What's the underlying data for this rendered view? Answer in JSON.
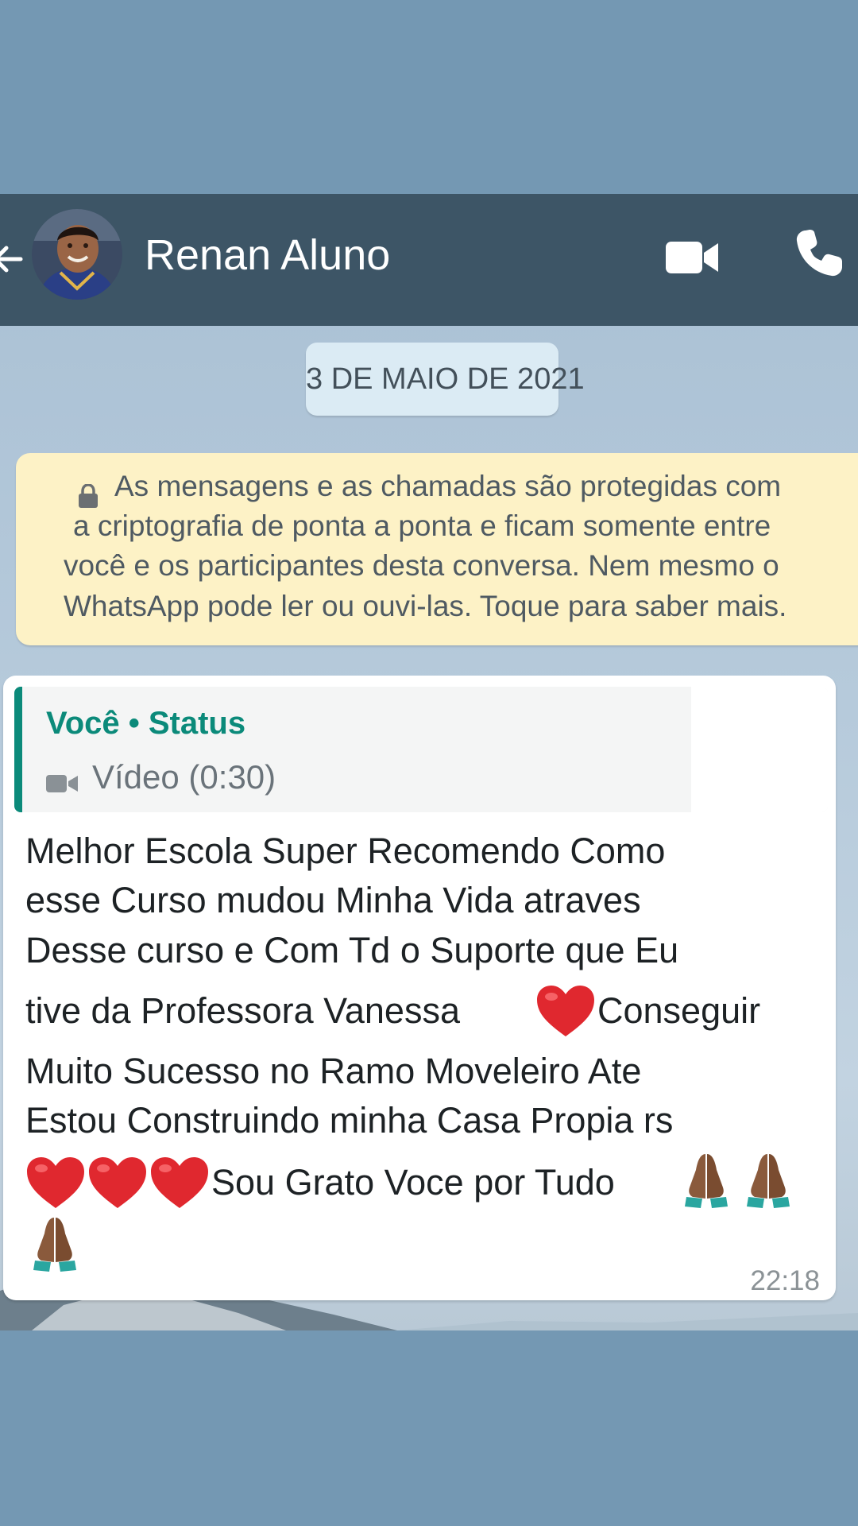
{
  "header": {
    "contact_name": "Renan Aluno",
    "icons": [
      "back-arrow-icon",
      "avatar",
      "video-call-icon",
      "voice-call-icon"
    ]
  },
  "date_chip": "3 DE MAIO DE 2021",
  "encryption_notice": {
    "lines": [
      "As mensagens e as chamadas são protegidas com",
      "a criptografia de ponta a ponta e ficam somente entre",
      "você e os participantes desta conversa. Nem mesmo o",
      "WhatsApp pode ler ou ouvi-las. Toque para saber mais."
    ]
  },
  "message": {
    "quote": {
      "author": "Você • Status",
      "media_label": "Vídeo (0:30)"
    },
    "lines": [
      "Melhor Escola Super Recomendo Como",
      "esse Curso mudou Minha Vida atraves",
      "Desse curso e Com Td o Suporte que Eu",
      "tive da Professora Vanessa",
      " Conseguir",
      "Muito Sucesso no Ramo Moveleiro Ate",
      "Estou Construindo minha Casa Propia rs",
      "Sou Grato Voce por Tudo"
    ],
    "emoji": [
      "❤️",
      "❤️",
      "❤️",
      "❤️",
      "🙏🏾",
      "🙏🏾",
      "🙏🏾"
    ],
    "time": "22:18"
  },
  "colors": {
    "outer_background": "#7498b3",
    "header": "#3d5566",
    "date_chip": "#dbebf4",
    "notice": "#fdf2c6",
    "quote_accent": "#0b8a7a",
    "heart": "#e0282f",
    "prayer_hands": "#8a5a3c"
  }
}
